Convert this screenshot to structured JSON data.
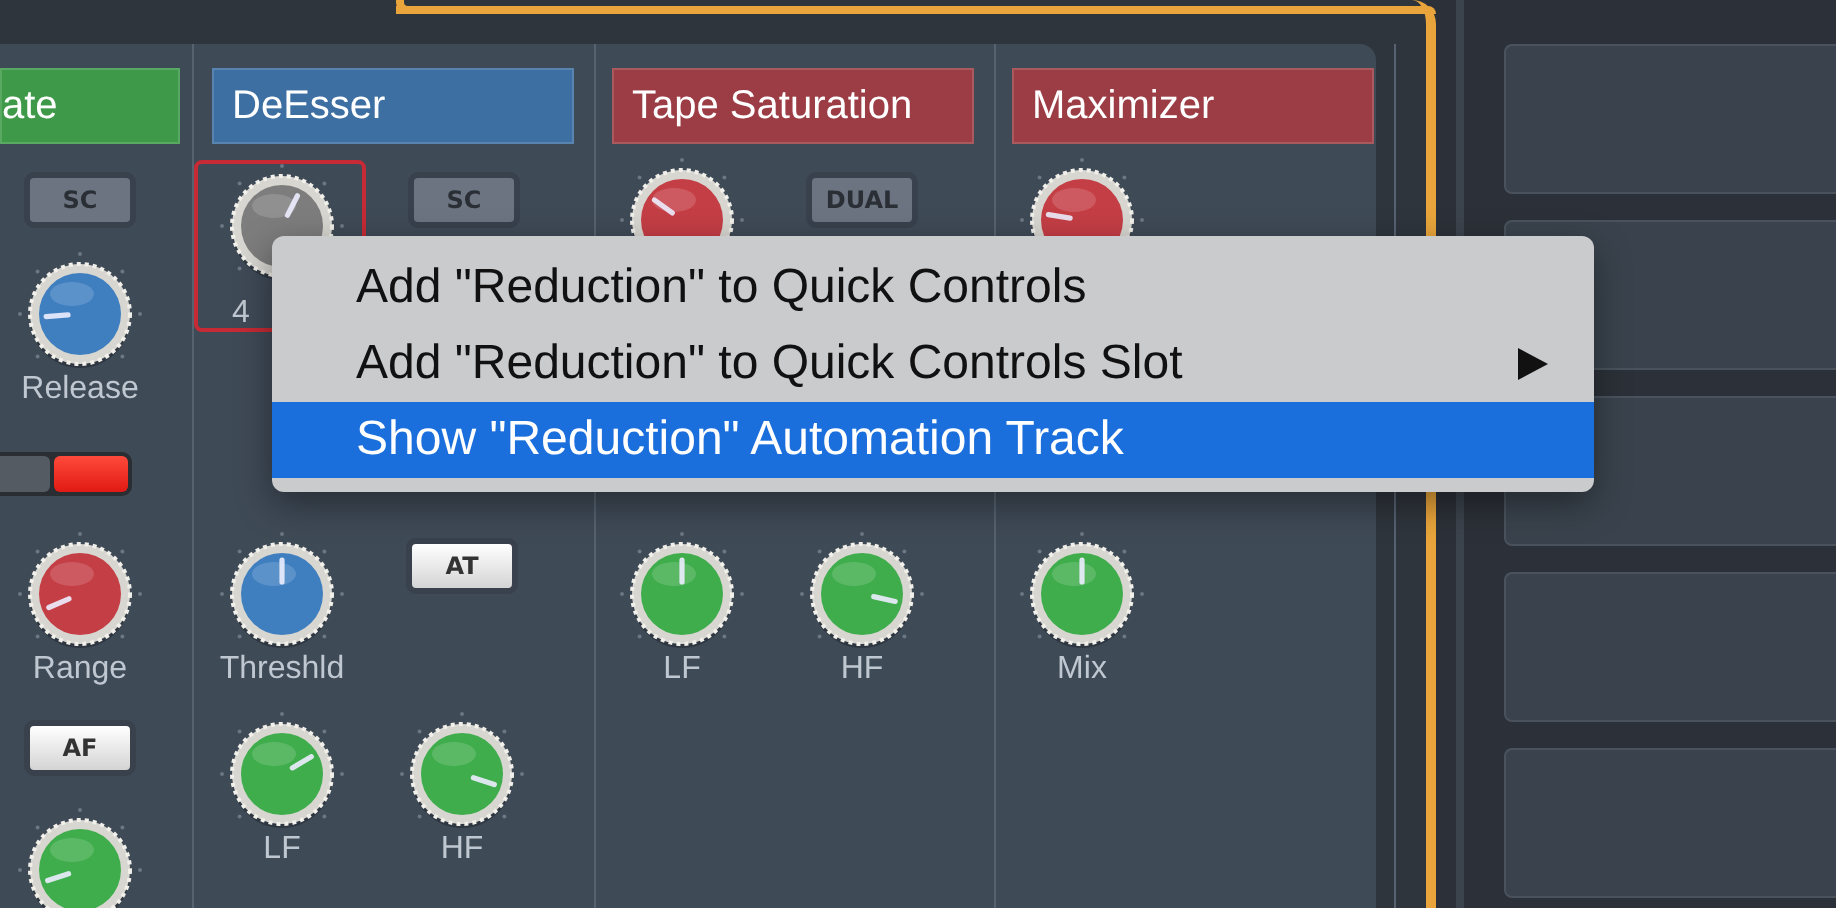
{
  "modules": [
    {
      "title": "ate",
      "color": "#3e9a48",
      "controls": [
        {
          "kind": "button",
          "label": "SC",
          "on": false
        },
        {
          "kind": "knob",
          "color": "#3f7fc0",
          "label": "Release"
        },
        {
          "kind": "toggle",
          "on": true
        },
        {
          "kind": "knob",
          "color": "#c43e45",
          "label": "Range"
        },
        {
          "kind": "button",
          "label": "AF",
          "on": true
        },
        {
          "kind": "knob",
          "color": "#3fad4c"
        }
      ]
    },
    {
      "title": "DeEsser",
      "color": "#3d6fa2",
      "controls": [
        {
          "kind": "knob",
          "color": "#7d7d7d",
          "label": "4",
          "selected": true
        },
        {
          "kind": "button",
          "label": "SC",
          "on": false
        },
        {
          "kind": "button",
          "label": "AT",
          "on": true
        },
        {
          "kind": "knob",
          "color": "#3f7fc0",
          "label": "Threshld"
        },
        {
          "kind": "knob",
          "color": "#3fad4c",
          "label": "LF"
        },
        {
          "kind": "knob",
          "color": "#3fad4c",
          "label": "HF"
        }
      ]
    },
    {
      "title": "Tape Saturation",
      "color": "#9c3c44",
      "controls": [
        {
          "kind": "knob",
          "color": "#c43e45"
        },
        {
          "kind": "button",
          "label": "DUAL",
          "on": false
        },
        {
          "kind": "knob",
          "color": "#3fad4c",
          "label": "LF"
        },
        {
          "kind": "knob",
          "color": "#3fad4c",
          "label": "HF"
        }
      ]
    },
    {
      "title": "Maximizer",
      "color": "#9c3c44",
      "controls": [
        {
          "kind": "knob",
          "color": "#c43e45"
        },
        {
          "kind": "knob",
          "color": "#3fad4c",
          "label": "Mix"
        }
      ]
    }
  ],
  "menu": {
    "items": [
      {
        "label": "Add \"Reduction\" to Quick Controls",
        "submenu": false,
        "selected": false
      },
      {
        "label": "Add \"Reduction\" to Quick Controls Slot",
        "submenu": true,
        "selected": false
      },
      {
        "label": "Show \"Reduction\" Automation Track",
        "submenu": false,
        "selected": true
      }
    ]
  }
}
